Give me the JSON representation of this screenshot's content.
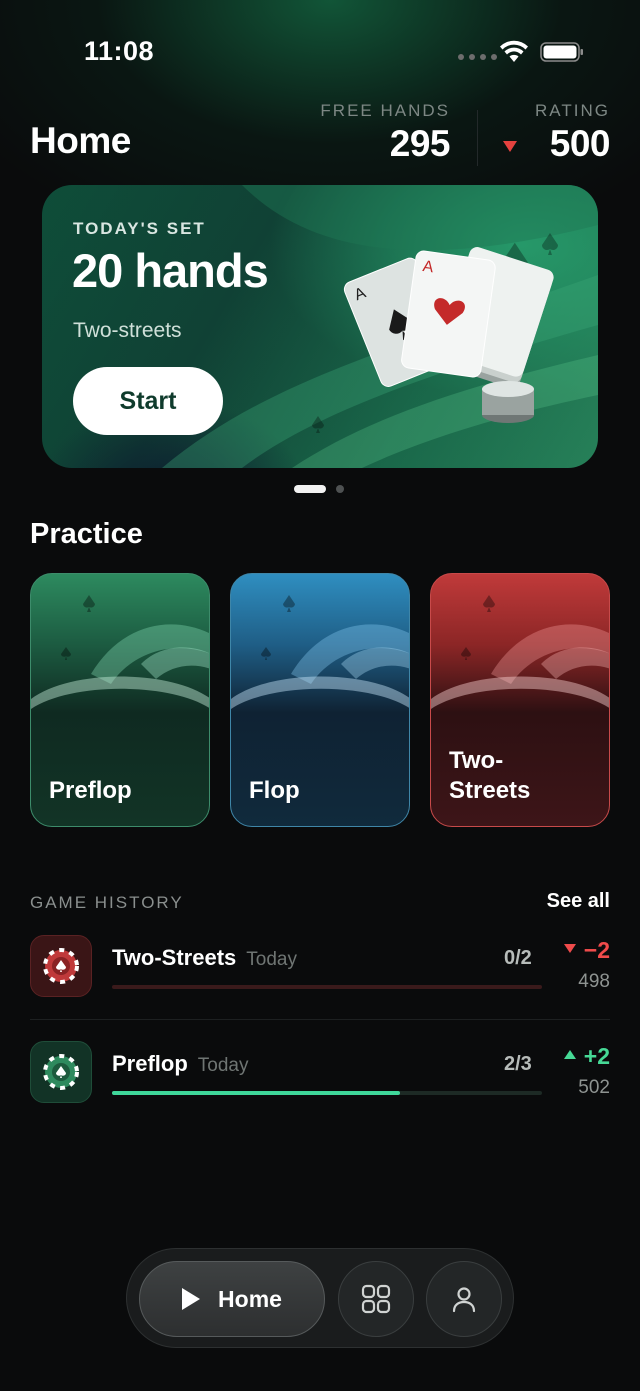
{
  "status_bar": {
    "time": "11:08"
  },
  "header": {
    "title": "Home",
    "free_hands_label": "FREE HANDS",
    "free_hands_value": "295",
    "rating_label": "RATING",
    "rating_value": "500",
    "rating_trend": "down"
  },
  "banner": {
    "kicker": "TODAY'S SET",
    "title": "20 hands",
    "subtitle": "Two-streets",
    "button_label": "Start",
    "pages": 2,
    "active_page": 1
  },
  "practice": {
    "title": "Practice",
    "cards": [
      {
        "label": "Preflop",
        "theme": "green"
      },
      {
        "label": "Flop",
        "theme": "blue"
      },
      {
        "label": "Two-\nStreets",
        "theme": "red"
      }
    ]
  },
  "history": {
    "label": "GAME HISTORY",
    "see_all": "See all",
    "rows": [
      {
        "name": "Two-Streets",
        "date": "Today",
        "score": "0/2",
        "progress": 0,
        "delta": "−2",
        "trend": "down",
        "rating": "498",
        "chip_color": "#c0393a"
      },
      {
        "name": "Preflop",
        "date": "Today",
        "score": "2/3",
        "progress": 0.67,
        "delta": "+2",
        "trend": "up",
        "rating": "502",
        "chip_color": "#2e8a5e"
      }
    ]
  },
  "tab_bar": {
    "home_label": "Home",
    "icons": [
      "play-icon",
      "grid-icon",
      "profile-icon"
    ]
  },
  "colors": {
    "background": "#0a0b0c",
    "accent_green": "#3fd79a",
    "negative_red": "#ef4b4b",
    "muted": "#7d8784"
  }
}
